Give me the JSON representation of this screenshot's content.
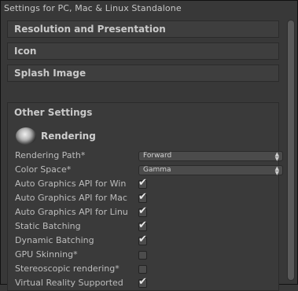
{
  "window": {
    "title": "Settings for PC, Mac & Linux Standalone"
  },
  "sections": [
    {
      "label": "Resolution and Presentation"
    },
    {
      "label": "Icon"
    },
    {
      "label": "Splash Image"
    }
  ],
  "other": {
    "label": "Other Settings",
    "rendering_label": "Rendering",
    "rows": [
      {
        "label": "Rendering Path*",
        "type": "select",
        "value": "Forward"
      },
      {
        "label": "Color Space*",
        "type": "select",
        "value": "Gamma"
      },
      {
        "label": "Auto Graphics API for Win",
        "type": "checkbox",
        "checked": true
      },
      {
        "label": "Auto Graphics API for Mac",
        "type": "checkbox",
        "checked": true
      },
      {
        "label": "Auto Graphics API for Linu",
        "type": "checkbox",
        "checked": true
      },
      {
        "label": "Static Batching",
        "type": "checkbox",
        "checked": true
      },
      {
        "label": "Dynamic Batching",
        "type": "checkbox",
        "checked": true
      },
      {
        "label": "GPU Skinning*",
        "type": "checkbox",
        "checked": false
      },
      {
        "label": "Stereoscopic rendering*",
        "type": "checkbox",
        "checked": false
      },
      {
        "label": "Virtual Reality Supported",
        "type": "checkbox",
        "checked": true
      }
    ]
  },
  "icons": {
    "rendering": "rendering-sphere-icon",
    "check": "checkmark-icon",
    "select_arrows": "up-down-arrows-icon"
  },
  "colors": {
    "background": "#383838",
    "text": "#bdbdbd",
    "header": "#3e3e3e"
  }
}
